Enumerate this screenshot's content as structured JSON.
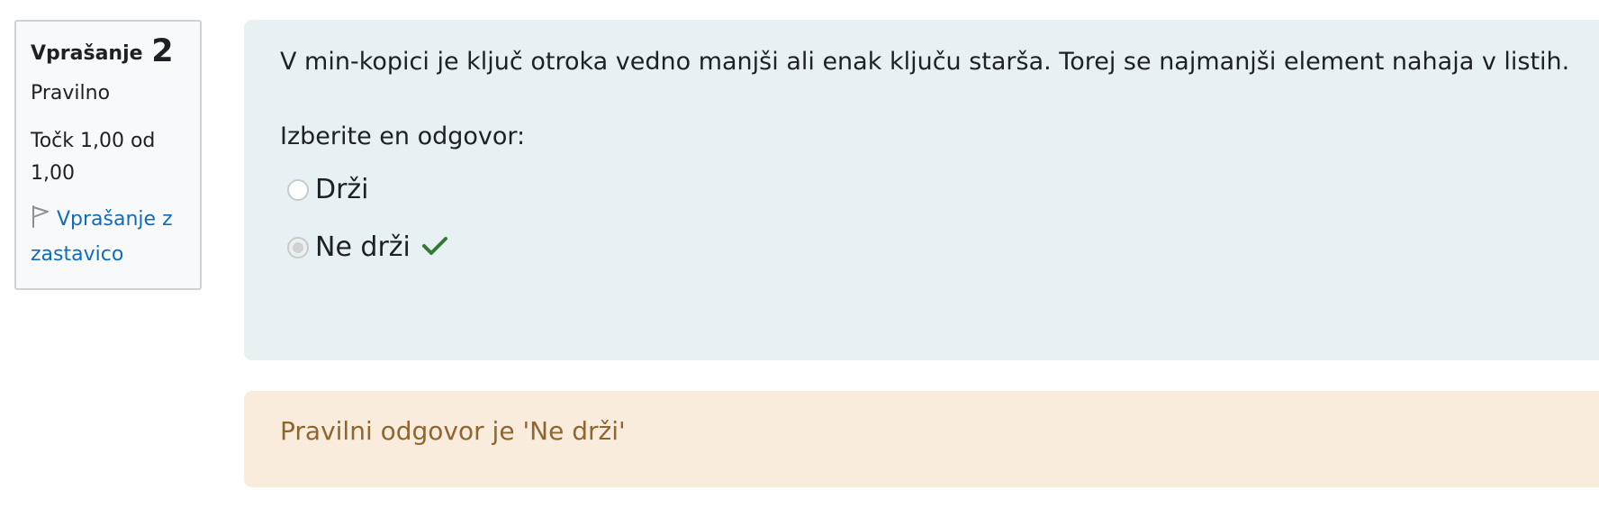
{
  "info": {
    "question_word": "Vprašanje",
    "question_number": "2",
    "state": "Pravilno",
    "grade": "Točk 1,00 od 1,00",
    "flag_label": "Vprašanje z zastavico",
    "flag_icon": "flag-outline-icon"
  },
  "question": {
    "text": "V min-kopici je ključ otroka vedno manjši ali enak ključu starša. Torej se najmanjši element nahaja v listih.",
    "prompt": "Izberite en odgovor:",
    "options": [
      {
        "label": "Drži",
        "selected": false
      },
      {
        "label": "Ne drži",
        "selected": true,
        "marked_correct": true
      }
    ]
  },
  "feedback": {
    "right_answer": "Pravilni odgovor je 'Ne drži'"
  },
  "colors": {
    "info_bg": "#f8f9fa",
    "formulation_bg": "#e7f1f4",
    "feedback_bg": "#f9ecdc",
    "feedback_text": "#8e662e",
    "link": "#0f6cbf",
    "correct_check": "#357a32"
  }
}
